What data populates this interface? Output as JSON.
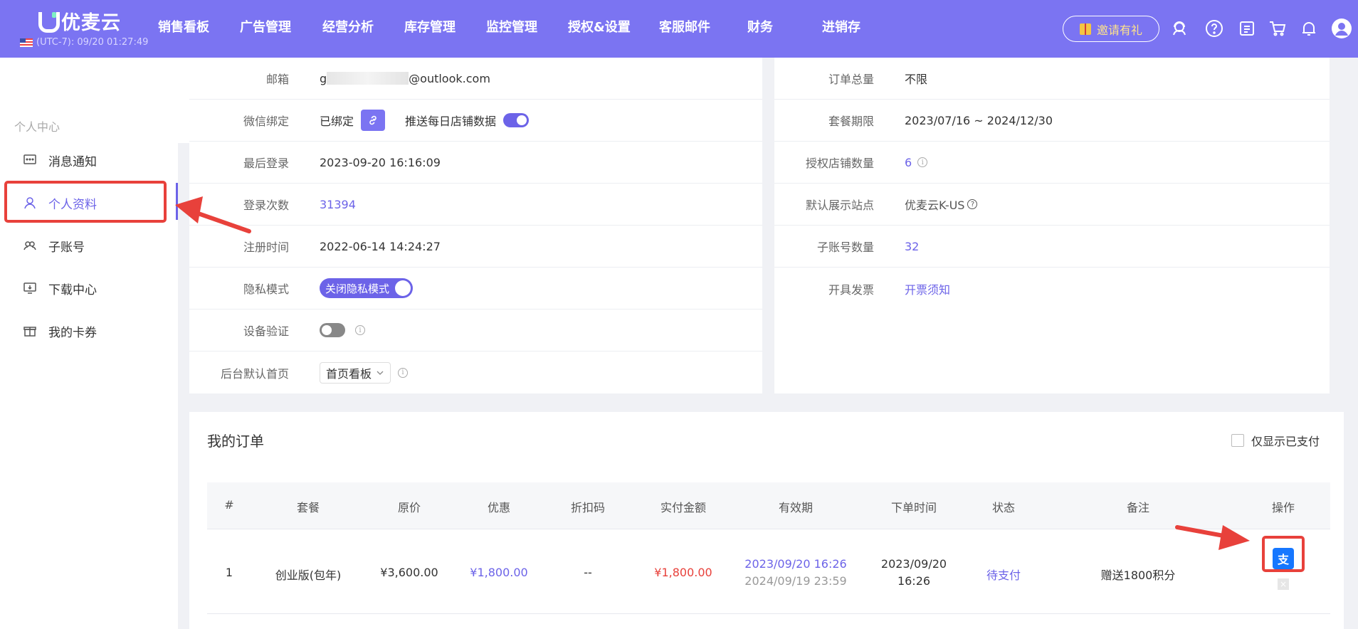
{
  "header": {
    "logo_text": "优麦云",
    "timezone": "(UTC-7): 09/20 01:27:49",
    "nav": [
      "销售看板",
      "广告管理",
      "经营分析",
      "库存管理",
      "监控管理",
      "授权&设置",
      "客服邮件",
      "财务",
      "进销存"
    ],
    "invite_label": "邀请有礼",
    "icons": [
      "headset-icon",
      "help-icon",
      "notes-icon",
      "cart-icon",
      "bell-icon",
      "avatar-icon"
    ]
  },
  "sidebar": {
    "section": "个人中心",
    "items": [
      {
        "label": "消息通知",
        "icon": "message-icon"
      },
      {
        "label": "个人资料",
        "icon": "user-icon"
      },
      {
        "label": "子账号",
        "icon": "sub-account-icon"
      },
      {
        "label": "下载中心",
        "icon": "download-icon"
      },
      {
        "label": "我的卡券",
        "icon": "gift-icon"
      }
    ]
  },
  "profile": {
    "email_label": "邮箱",
    "email_prefix": "g",
    "email_suffix": "@outlook.com",
    "wechat_label": "微信绑定",
    "wechat_value": "已绑定",
    "push_label": "推送每日店铺数据",
    "last_login_label": "最后登录",
    "last_login_value": "2023-09-20 16:16:09",
    "login_count_label": "登录次数",
    "login_count_value": "31394",
    "register_label": "注册时间",
    "register_value": "2022-06-14 14:24:27",
    "privacy_label": "隐私模式",
    "privacy_value": "关闭隐私模式",
    "device_label": "设备验证",
    "homepage_label": "后台默认首页",
    "homepage_value": "首页看板"
  },
  "plan": {
    "orders_total_label": "订单总量",
    "orders_total_value": "不限",
    "period_label": "套餐期限",
    "period_value": "2023/07/16 ~ 2024/12/30",
    "shops_label": "授权店铺数量",
    "shops_value": "6",
    "site_label": "默认展示站点",
    "site_value": "优麦云K-US",
    "sub_count_label": "子账号数量",
    "sub_count_value": "32",
    "invoice_label": "开具发票",
    "invoice_value": "开票须知"
  },
  "orders": {
    "title": "我的订单",
    "only_paid_label": "仅显示已支付",
    "columns": [
      "#",
      "套餐",
      "原价",
      "优惠",
      "折扣码",
      "实付金额",
      "有效期",
      "下单时间",
      "状态",
      "备注",
      "操作"
    ],
    "rows": [
      {
        "index": "1",
        "plan": "创业版(包年)",
        "price": "¥3,600.00",
        "discount": "¥1,800.00",
        "code": "--",
        "paid": "¥1,800.00",
        "valid_start": "2023/09/20 16:26",
        "valid_end": "2024/09/19 23:59",
        "order_date": "2023/09/20",
        "order_time": "16:26",
        "status": "待支付",
        "remark": "赠送1800积分",
        "pay_icon": "alipay-icon",
        "cancel_icon": "close-icon"
      }
    ]
  },
  "colors": {
    "brand": "#7b74f2",
    "accent": "#6c63e8",
    "annotation": "#e8413b"
  }
}
